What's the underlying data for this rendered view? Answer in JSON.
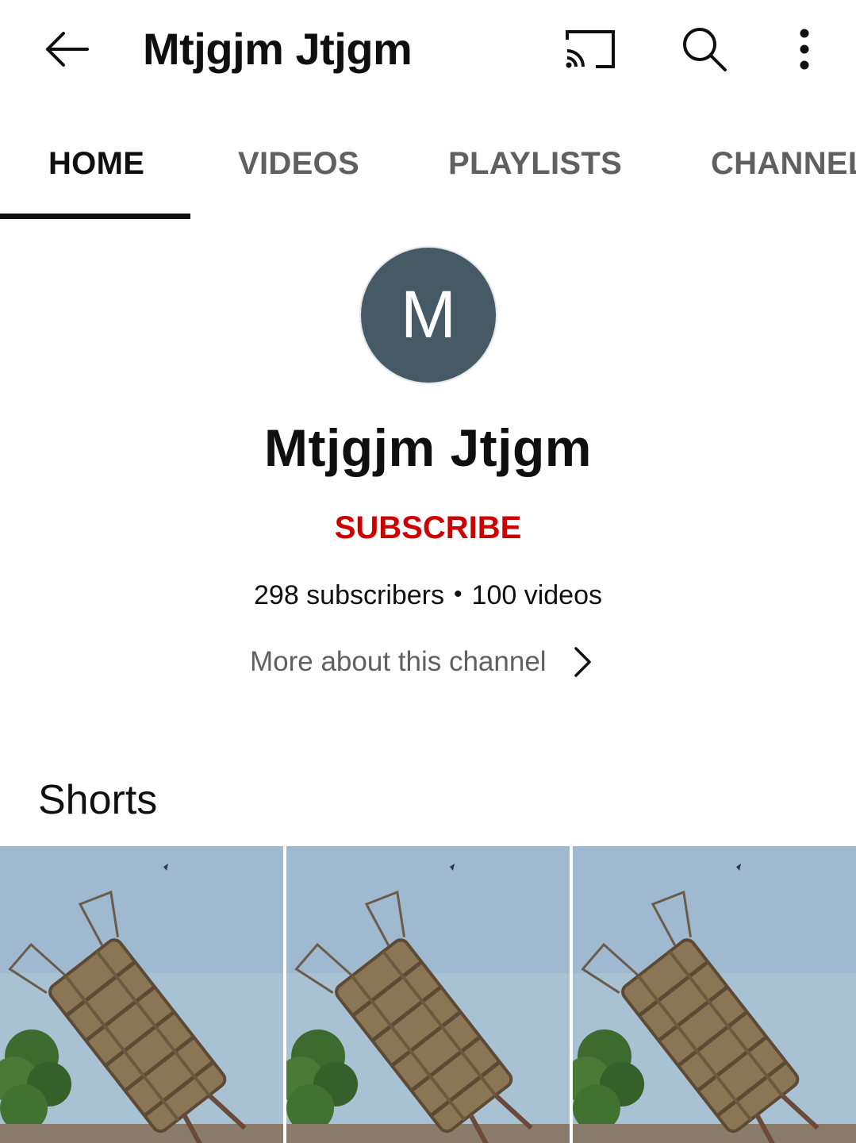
{
  "app_bar": {
    "title": "Mtjgjm Jtjgm",
    "icons": [
      "back-arrow-icon",
      "cast-icon",
      "search-icon",
      "more-vert-icon"
    ]
  },
  "tabs": [
    {
      "label": "HOME",
      "active": true
    },
    {
      "label": "VIDEOS",
      "active": false
    },
    {
      "label": "PLAYLISTS",
      "active": false
    },
    {
      "label": "CHANNEL",
      "active": false
    }
  ],
  "channel": {
    "avatar_letter": "M",
    "avatar_color": "#455a64",
    "name": "Mtjgjm Jtjgm",
    "subscribe_label": "SUBSCRIBE",
    "subscribe_color": "#cc0000",
    "subscribers": "298 subscribers",
    "separator": "•",
    "videos": "100 videos",
    "more_about": "More about this channel"
  },
  "shorts": {
    "title": "Shorts",
    "items": [
      {
        "thumbnail": "falling-water-tank-thumbnail"
      },
      {
        "thumbnail": "falling-water-tank-thumbnail"
      },
      {
        "thumbnail": "falling-water-tank-thumbnail"
      }
    ]
  }
}
